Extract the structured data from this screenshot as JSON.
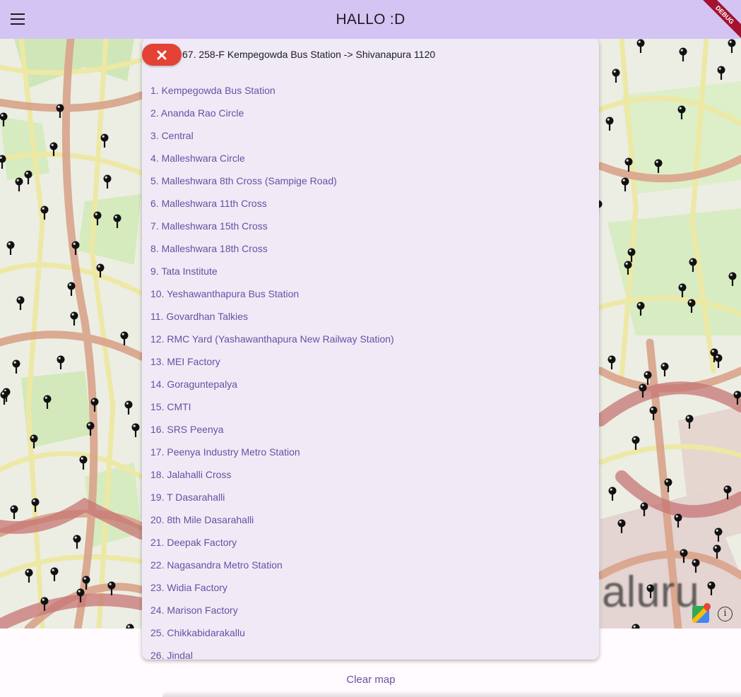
{
  "app_bar": {
    "title": "HALLO :D",
    "menu_icon": "menu-icon",
    "debug_banner": "DEBUG"
  },
  "map": {
    "city_label": "aluru",
    "map_style": "OpenStreetMap tiles with black bus-stop pins",
    "controls": [
      "maps-logo-icon",
      "info-icon"
    ]
  },
  "route_panel": {
    "route_title": "67. 258-F Kempegowda Bus Station -> Shivanapura 1120",
    "close_icon": "close-icon",
    "stops": [
      "1. Kempegowda Bus Station",
      "2. Ananda Rao Circle",
      "3. Central",
      "4. Malleshwara Circle",
      "5. Malleshwara 8th Cross (Sampige Road)",
      "6. Malleshwara 11th Cross",
      "7. Malleshwara 15th Cross",
      "8. Malleshwara 18th Cross",
      "9. Tata Institute",
      "10. Yeshawanthapura Bus Station",
      "11. Govardhan Talkies",
      "12. RMC Yard (Yashawanthapura New Railway Station)",
      "13. MEI Factory",
      "14. Goraguntepalya",
      "15. CMTI",
      "16. SRS Peenya",
      "17. Peenya Industry Metro Station",
      "18. Jalahalli Cross",
      "19. T Dasarahalli",
      "20. 8th Mile Dasarahalli",
      "21. Deepak Factory",
      "22. Nagasandra Metro Station",
      "23. Widia Factory",
      "24. Marison Factory",
      "25. Chikkabidarakallu",
      "26. Jindal"
    ]
  },
  "footer": {
    "clear_map_label": "Clear map"
  },
  "colors": {
    "app_bar": "#d4c4f4",
    "panel": "#f0eaf6",
    "accent_text": "#6750a4",
    "close_button": "#e34234",
    "map_background": "#eceee4",
    "road_primary": "#d9a38a",
    "road_secondary": "#ede8a4",
    "park": "#cfe7b8"
  }
}
